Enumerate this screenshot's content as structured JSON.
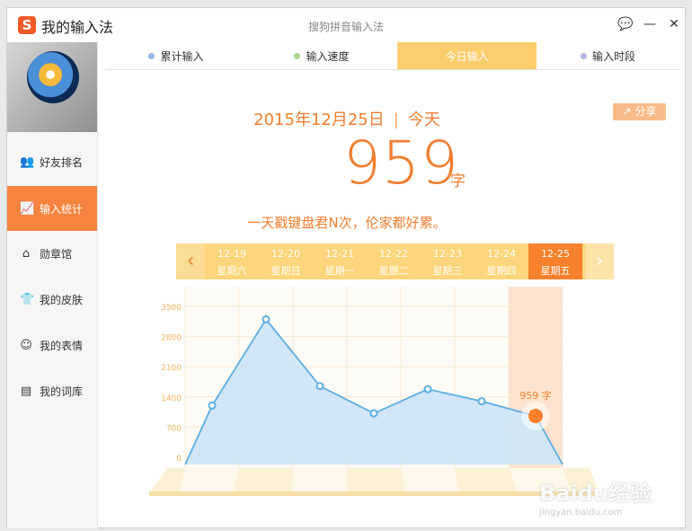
{
  "window": {
    "app_title": "我的输入法",
    "subtitle": "搜狗拼音输入法",
    "logo_letter": "S",
    "controls": {
      "feedback": "💬",
      "minimize": "—",
      "close": "✕"
    }
  },
  "sidebar": {
    "items": [
      {
        "label": "好友排名",
        "icon": "👥",
        "active": false
      },
      {
        "label": "输入统计",
        "icon": "📈",
        "active": true
      },
      {
        "label": "勋章馆",
        "icon": "⌂",
        "active": false
      },
      {
        "label": "我的皮肤",
        "icon": "👕",
        "active": false
      },
      {
        "label": "我的表情",
        "icon": "☺",
        "active": false
      },
      {
        "label": "我的词库",
        "icon": "▤",
        "active": false
      }
    ]
  },
  "tabs": [
    {
      "label": "累计输入",
      "dot_color": "#8fb8e3",
      "active": false
    },
    {
      "label": "输入速度",
      "dot_color": "#a6d88e",
      "active": false
    },
    {
      "label": "今日输入",
      "dot_color": "",
      "active": true
    },
    {
      "label": "输入时段",
      "dot_color": "#b0b7e8",
      "active": false
    }
  ],
  "summary": {
    "date": "2015年12月25日",
    "sep": "|",
    "today": "今天",
    "count": "959",
    "unit": "字",
    "slogan": "一天戳键盘君N次，伦家都好累。",
    "share_label": "分享",
    "share_icon": "↗"
  },
  "date_strip": {
    "prev_arrow": "‹",
    "next_arrow": "›",
    "days": [
      {
        "date": "12-19",
        "weekday": "星期六"
      },
      {
        "date": "12-20",
        "weekday": "星期日"
      },
      {
        "date": "12-21",
        "weekday": "星期一"
      },
      {
        "date": "12-22",
        "weekday": "星期二"
      },
      {
        "date": "12-23",
        "weekday": "星期三"
      },
      {
        "date": "12-24",
        "weekday": "星期四"
      },
      {
        "date": "12-25",
        "weekday": "星期五"
      }
    ],
    "active_index": 6
  },
  "chart_data": {
    "type": "area",
    "categories": [
      "12-19",
      "12-20",
      "12-21",
      "12-22",
      "12-23",
      "12-24",
      "12-25"
    ],
    "values": [
      1200,
      3200,
      1650,
      1020,
      1580,
      1300,
      959
    ],
    "ylim": [
      0,
      3500
    ],
    "yticks": [
      0,
      700,
      1400,
      2100,
      2800,
      3500
    ],
    "highlight_index": 6,
    "highlight_label": "959 字",
    "grid": true,
    "colors": {
      "line": "#5aaee3",
      "fill": "#cfe5f6",
      "highlight": "#fb7f2a",
      "tick": "#f6b25a"
    }
  },
  "watermark": {
    "main": "Baidu经验",
    "sub": "jingyan.baidu.com"
  }
}
